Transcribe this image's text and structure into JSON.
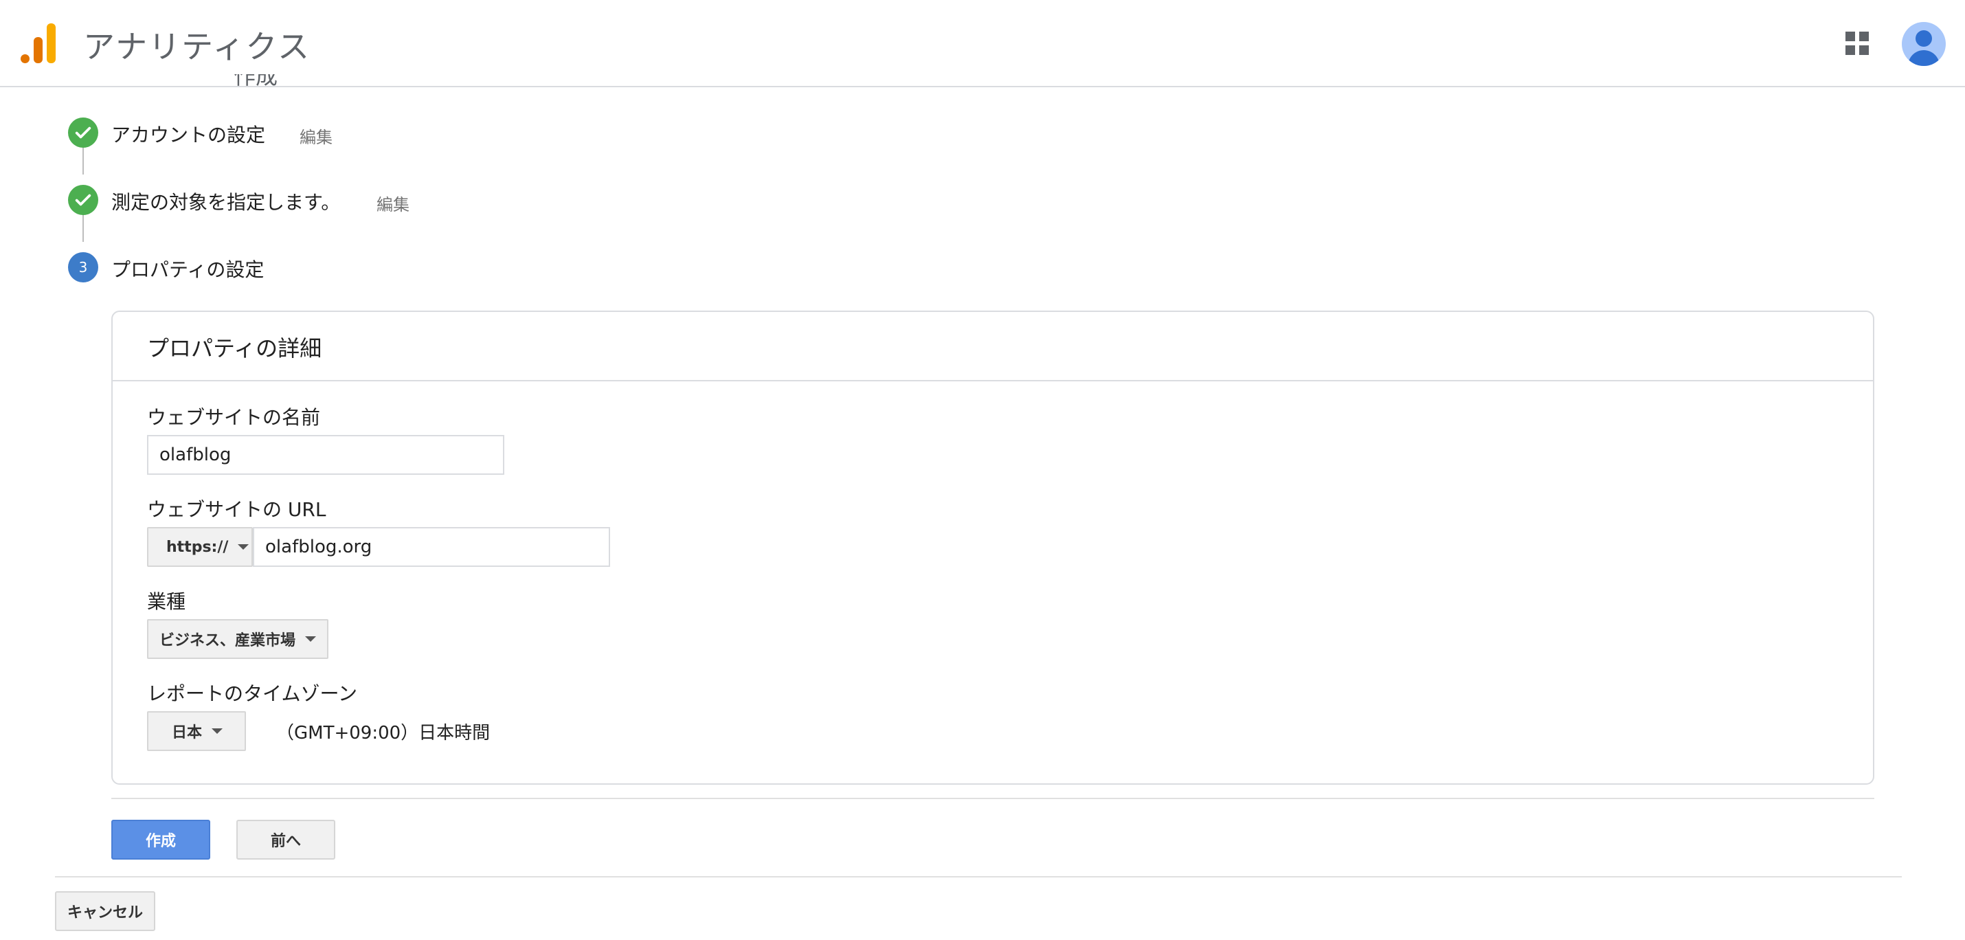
{
  "header": {
    "app_title": "アナリティクス",
    "brand_colors": [
      "#e37400",
      "#f9ab00"
    ],
    "apps_icon": "apps-grid-icon",
    "avatar_icon": "account-avatar-icon"
  },
  "stepper": {
    "clipped_text": "作成",
    "steps": [
      {
        "label": "アカウントの設定",
        "edit": "編集",
        "state": "done"
      },
      {
        "label": "測定の対象を指定します。",
        "edit": "編集",
        "state": "done"
      },
      {
        "label": "プロパティの設定",
        "number": "3",
        "state": "current"
      }
    ]
  },
  "property_card": {
    "title": "プロパティの詳細",
    "website_name": {
      "label": "ウェブサイトの名前",
      "value": "olafblog"
    },
    "website_url": {
      "label": "ウェブサイトの URL",
      "protocol": "https://",
      "value": "olafblog.org"
    },
    "industry": {
      "label": "業種",
      "value": "ビジネス、産業市場"
    },
    "timezone": {
      "label": "レポートのタイムゾーン",
      "country": "日本",
      "zone": "（GMT+09:00）日本時間"
    }
  },
  "actions": {
    "create": "作成",
    "previous": "前へ",
    "cancel": "キャンセル"
  },
  "colors": {
    "accent": "#5b90e6",
    "step_done": "#4caf50",
    "step_current": "#3d7cc9"
  }
}
